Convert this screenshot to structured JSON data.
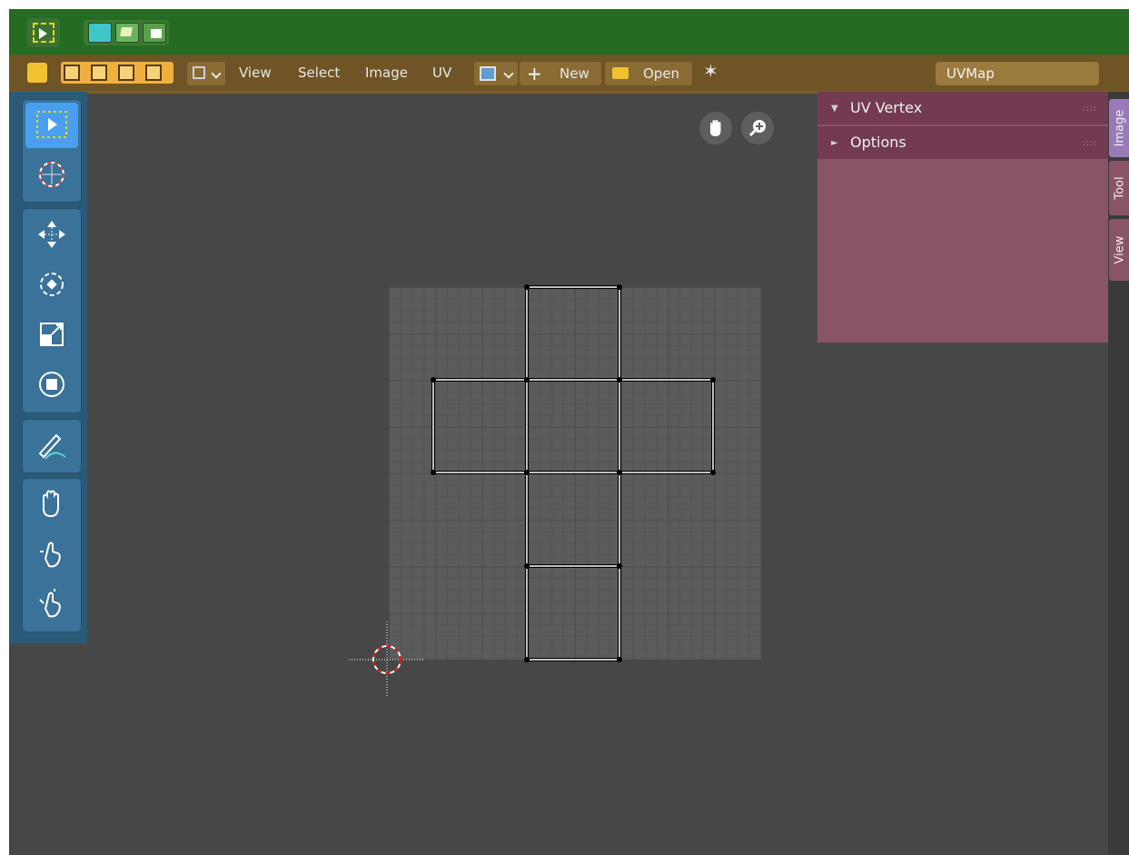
{
  "tool_settings": {
    "select_tool_icon": "select-box-icon",
    "select_modes": [
      "vertex-select-icon",
      "edge-select-icon",
      "face-select-icon"
    ]
  },
  "header": {
    "menus": [
      "View",
      "Select",
      "Image",
      "UV"
    ],
    "new_label": "New",
    "open_label": "Open",
    "uvmap_label": "UVMap"
  },
  "toolbar": {
    "tools": [
      "select-box",
      "cursor",
      "move",
      "rotate",
      "scale",
      "transform",
      "annotate",
      "grab",
      "relax",
      "pinch"
    ],
    "active_tool": "select-box"
  },
  "sidebar": {
    "panels": [
      {
        "label": "UV Vertex",
        "expanded": true
      },
      {
        "label": "Options",
        "expanded": false
      }
    ],
    "tabs": [
      "Image",
      "Tool",
      "View"
    ],
    "active_tab": "Image"
  },
  "colors": {
    "topbar": "#256b24",
    "header": "#6f5426",
    "toolbar": "#2a5a78",
    "sidebar": "#8a5468",
    "viewport": "#474747"
  }
}
